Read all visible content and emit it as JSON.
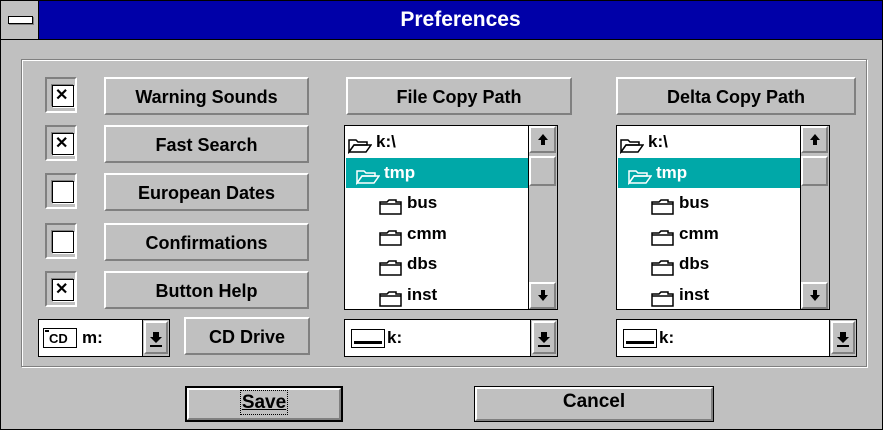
{
  "window": {
    "title": "Preferences"
  },
  "options": [
    {
      "label": "Warning Sounds",
      "checked": true
    },
    {
      "label": "Fast Search",
      "checked": true
    },
    {
      "label": "European Dates",
      "checked": false
    },
    {
      "label": "Confirmations",
      "checked": false
    },
    {
      "label": "Button Help",
      "checked": true
    }
  ],
  "cd_drive": {
    "label": "CD Drive",
    "selected": "m:",
    "icon_text": "CD"
  },
  "file_copy": {
    "header": "File Copy Path",
    "items": [
      {
        "name": "k:\\",
        "icon": "open-folder-icon"
      },
      {
        "name": "tmp",
        "icon": "open-folder-icon",
        "selected": true
      },
      {
        "name": "bus",
        "icon": "folder-icon"
      },
      {
        "name": "cmm",
        "icon": "folder-icon"
      },
      {
        "name": "dbs",
        "icon": "folder-icon"
      },
      {
        "name": "inst",
        "icon": "folder-icon"
      }
    ],
    "drive": "k:"
  },
  "delta_copy": {
    "header": "Delta Copy Path",
    "items": [
      {
        "name": "k:\\",
        "icon": "open-folder-icon"
      },
      {
        "name": "tmp",
        "icon": "open-folder-icon",
        "selected": true
      },
      {
        "name": "bus",
        "icon": "folder-icon"
      },
      {
        "name": "cmm",
        "icon": "folder-icon"
      },
      {
        "name": "dbs",
        "icon": "folder-icon"
      },
      {
        "name": "inst",
        "icon": "folder-icon"
      }
    ],
    "drive": "k:"
  },
  "buttons": {
    "save": "Save",
    "cancel": "Cancel"
  },
  "colors": {
    "title_bar": "#0000a8",
    "selection": "#00a8a8",
    "face": "#c0c0c0"
  }
}
